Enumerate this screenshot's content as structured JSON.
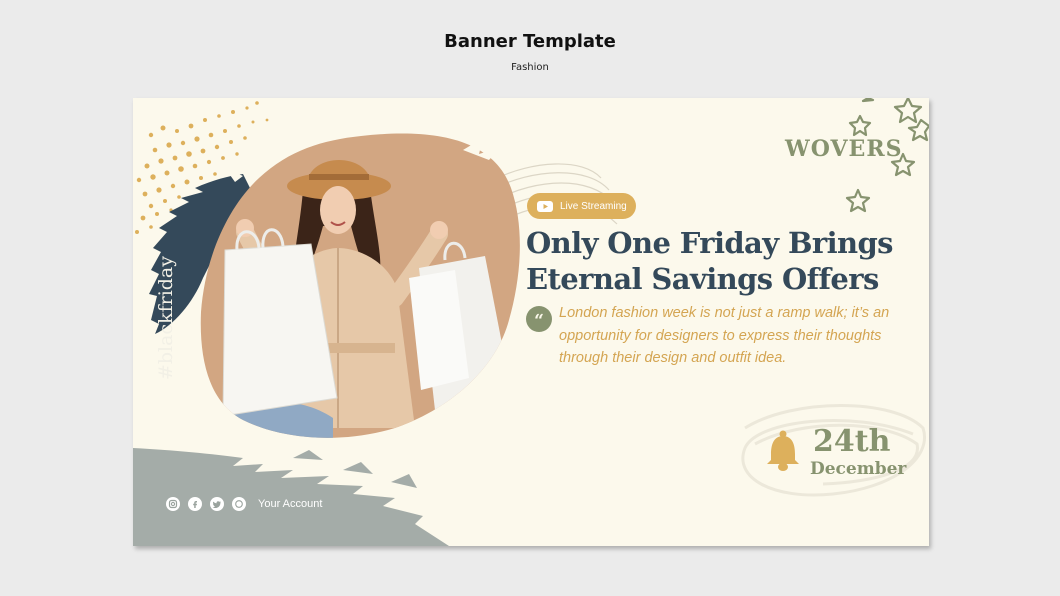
{
  "header": {
    "title": "Banner Template",
    "subtitle": "Fashion"
  },
  "banner": {
    "hashtag": "#blackfriday",
    "brand": "WOVERS",
    "live_badge": "Live Streaming",
    "headline": "Only One Friday Brings Eternal Savings Offers",
    "description": "London fashion week is not just a ramp walk; it’s an opportunity for designers to express their thoughts through their design and outfit idea.",
    "event_day": "24th",
    "event_month": "December",
    "account_label": "Your Account",
    "social_icons": [
      "instagram-icon",
      "facebook-icon",
      "twitter-icon",
      "whatsapp-icon"
    ],
    "photo": "woman in beige trench coat and tan hat holding white shopping bags"
  },
  "colors": {
    "background": "#ebebeb",
    "banner_bg": "#fcf9ec",
    "navy": "#34495a",
    "gold": "#ddb05c",
    "olive": "#87936f",
    "slate": "#a4aca8",
    "photo_bg": "#d2a682"
  }
}
